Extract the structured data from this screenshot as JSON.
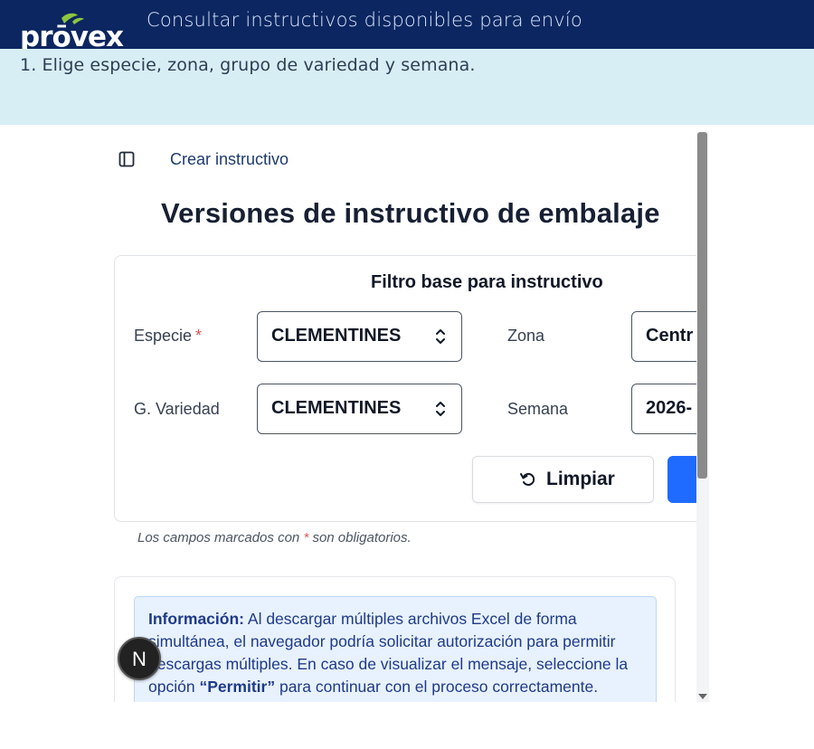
{
  "header": {
    "logo_text": "prōvex",
    "title": "Consultar instructivos disponibles para envío"
  },
  "step": {
    "text": "1. Elige especie, zona, grupo de variedad y semana."
  },
  "app": {
    "breadcrumb": "Crear instructivo",
    "page_title": "Versiones de instructivo de embalaje",
    "filter": {
      "title": "Filtro base para instructivo",
      "especie_label": "Especie",
      "required_mark": "*",
      "especie_value": "CLEMENTINES",
      "zona_label": "Zona",
      "zona_value": "Centr",
      "variedad_label": "G. Variedad",
      "variedad_value": "CLEMENTINES",
      "semana_label": "Semana",
      "semana_value": "2026-",
      "clear_label": "Limpiar"
    },
    "note_prefix": "Los campos marcados con",
    "note_mark": "*",
    "note_suffix": "son obligatorios.",
    "info": {
      "label": "Información:",
      "text_1": "Al descargar múltiples archivos Excel de forma simultánea, el navegador podría solicitar autorización para permitir descargas múltiples. En caso de visualizar el mensaje, seleccione la opción",
      "emphasis": "“Permitir”",
      "text_2": "para continuar con el proceso correctamente."
    },
    "badge": "N"
  },
  "colors": {
    "header_bg": "#0b2660",
    "step_bg": "#d7eef5",
    "primary": "#1f6bff",
    "info_bg": "#e8f2fe",
    "required": "#e05252"
  }
}
